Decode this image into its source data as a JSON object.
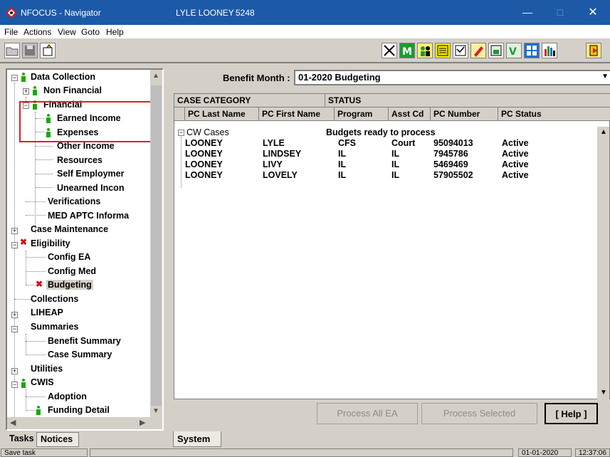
{
  "window": {
    "title": "NFOCUS - Navigator",
    "user": "LYLE LOONEY",
    "worker_id": "5248",
    "controls": {
      "minimize": "—",
      "maximize": "□",
      "close": "✕"
    }
  },
  "menu": [
    "File",
    "Actions",
    "View",
    "Goto",
    "Help"
  ],
  "tree": {
    "items": {
      "data_collection": "Data Collection",
      "non_financial": "Non Financial",
      "financial": "Financial",
      "earned_income": "Earned Income",
      "expenses": "Expenses",
      "other_income": "Other Income",
      "resources": "Resources",
      "self_employment": "Self Employmer",
      "unearned_income": "Unearned Incon",
      "verifications": "Verifications",
      "med_aptc": "MED APTC Informa",
      "case_maintenance": "Case Maintenance",
      "eligibility": "Eligibility",
      "config_ea": "Config EA",
      "config_med": "Config Med",
      "budgeting": "Budgeting",
      "collections": "Collections",
      "liheap": "LIHEAP",
      "summaries": "Summaries",
      "benefit_summary": "Benefit Summary",
      "case_summary": "Case Summary",
      "utilities": "Utilities",
      "cwis": "CWIS",
      "adoption": "Adoption",
      "funding_detail": "Funding Detail"
    }
  },
  "left_tabs": {
    "tasks": "Tasks",
    "notices": "Notices"
  },
  "benefit_month": {
    "label": "Benefit Month :",
    "value": "01-2020  Budgeting"
  },
  "grid": {
    "top_headers": {
      "case_category": "CASE CATEGORY",
      "status": "STATUS"
    },
    "columns": {
      "last_name": "PC Last Name",
      "first_name": "PC First Name",
      "program": "Program",
      "asst_cd": "Asst Cd",
      "pc_number": "PC Number",
      "pc_status": "PC Status"
    },
    "group": {
      "name": "CW Cases",
      "status": "Budgets ready to process"
    },
    "rows": [
      {
        "last": "LOONEY",
        "first": "LYLE",
        "program": "CFS",
        "asst": "Court",
        "number": "95094013",
        "status": "Active"
      },
      {
        "last": "LOONEY",
        "first": "LINDSEY",
        "program": "IL",
        "asst": "IL",
        "number": "7945786",
        "status": "Active"
      },
      {
        "last": "LOONEY",
        "first": "LIVY",
        "program": "IL",
        "asst": "IL",
        "number": "5469469",
        "status": "Active"
      },
      {
        "last": "LOONEY",
        "first": "LOVELY",
        "program": "IL",
        "asst": "IL",
        "number": "57905502",
        "status": "Active"
      }
    ]
  },
  "buttons": {
    "process_all": "Process All EA",
    "process_selected": "Process Selected",
    "help": "[ Help ]"
  },
  "right_tabs": {
    "system": "System"
  },
  "statusbar": {
    "message": "Save task",
    "date": "01-01-2020",
    "time": "12:37:06"
  },
  "colors": {
    "titlebar": "#1c5aa8",
    "highlight_box": "#e02020",
    "tree_status_green": "#18a800",
    "tree_status_red": "#d31010"
  },
  "icons": [
    "app-logo-icon",
    "open-folder-icon",
    "save-icon",
    "new-icon",
    "toolbar-icons",
    "chart-icon",
    "exit-icon",
    "green-person-icon",
    "red-x-icon"
  ]
}
